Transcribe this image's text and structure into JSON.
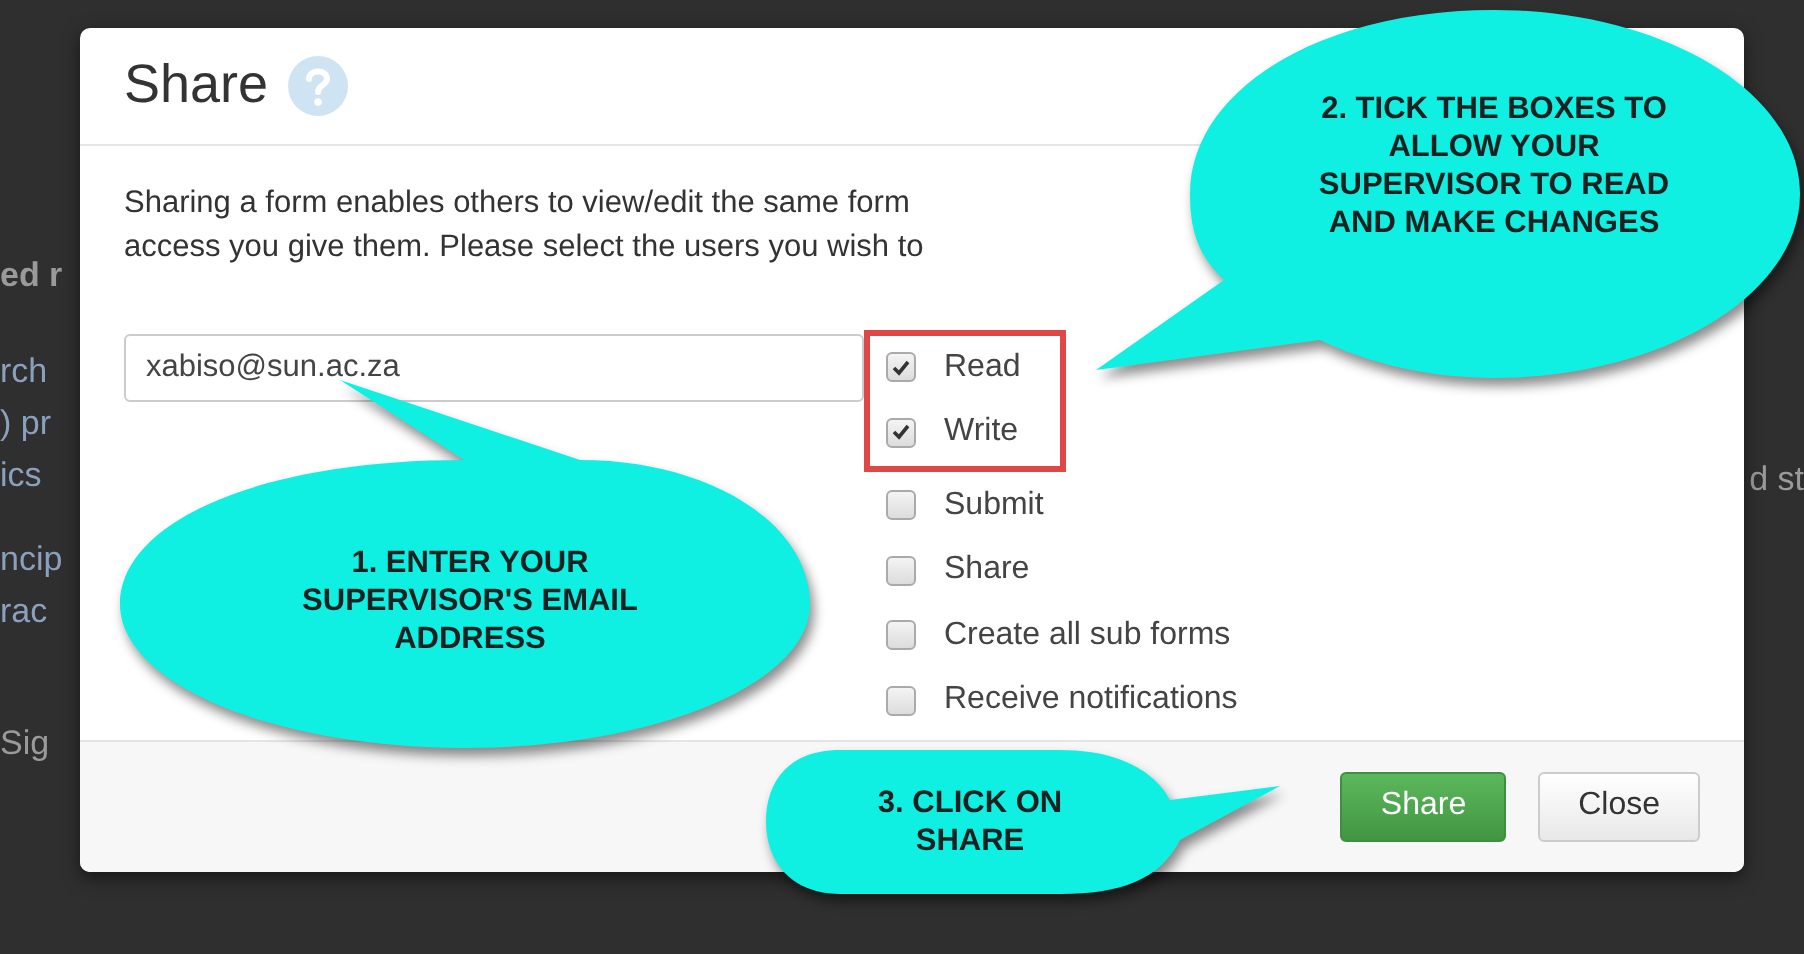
{
  "background_page": {
    "left_fragments": [
      "ed r",
      "rch",
      ") pr",
      "ics",
      "ncip",
      "rac",
      "Sig"
    ],
    "right_fragment": "d st"
  },
  "dialog": {
    "title": "Share",
    "description_lines": [
      "Sharing a form enables others to view/edit the same form",
      "access you give them. Please select the users you wish to"
    ],
    "email": {
      "value": "xabiso@sun.ac.za"
    },
    "permissions": [
      {
        "label": "Read",
        "checked": true,
        "highlighted": true
      },
      {
        "label": "Write",
        "checked": true,
        "highlighted": true
      },
      {
        "label": "Submit",
        "checked": false,
        "highlighted": false
      },
      {
        "label": "Share",
        "checked": false,
        "highlighted": false
      },
      {
        "label": "Create all sub forms",
        "checked": false,
        "highlighted": false
      },
      {
        "label": "Receive notifications",
        "checked": false,
        "highlighted": false
      }
    ],
    "buttons": [
      {
        "label": "Share",
        "kind": "primary"
      },
      {
        "label": "Close",
        "kind": "default"
      }
    ]
  },
  "callouts": [
    {
      "text": "1. ENTER YOUR SUPERVISOR'S EMAIL ADDRESS"
    },
    {
      "text": "2. TICK THE BOXES TO ALLOW YOUR SUPERVISOR TO READ AND MAKE CHANGES"
    },
    {
      "text": "3. CLICK ON SHARE"
    }
  ]
}
